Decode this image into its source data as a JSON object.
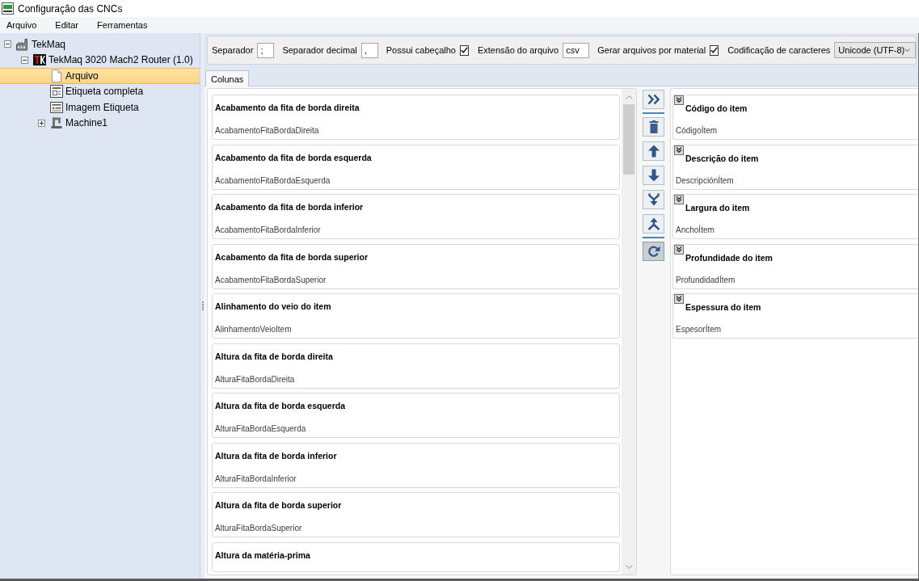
{
  "window": {
    "title": "Configuração das CNCs"
  },
  "menu": [
    "Arquivo",
    "Editar",
    "Ferramentas"
  ],
  "tree": [
    {
      "label": "TekMaq",
      "kind": "factory",
      "expanded": true,
      "selected": false,
      "children": [
        {
          "label": "TekMaq 3020 Mach2 Router (1.0)",
          "kind": "router",
          "expanded": true,
          "selected": false,
          "children": [
            {
              "label": "Arquivo",
              "kind": "file",
              "selected": true
            },
            {
              "label": "Etiqueta completa",
              "kind": "label",
              "selected": false
            },
            {
              "label": "Imagem Etiqueta",
              "kind": "image",
              "selected": false
            },
            {
              "label": "Machine1",
              "kind": "machine",
              "expanded": false,
              "selected": false
            }
          ]
        }
      ]
    }
  ],
  "options": [
    {
      "kind": "text",
      "label": "Separador",
      "value": ";"
    },
    {
      "kind": "text",
      "label": "Separador decimal",
      "value": ","
    },
    {
      "kind": "checkbox",
      "label": "Possui cabeçalho",
      "checked": true
    },
    {
      "kind": "text",
      "label": "Extensão do arquivo",
      "value": "csv"
    },
    {
      "kind": "checkbox",
      "label": "Gerar arquivos por material",
      "checked": true
    },
    {
      "kind": "dropdown",
      "label": "Codificação de caracteres",
      "value": "Unicode (UTF-8)"
    }
  ],
  "tabs": [
    {
      "label": "Colunas",
      "selected": true
    }
  ],
  "available_columns": [
    {
      "title": "Acabamento da fita de borda direita",
      "field": "AcabamentoFitaBordaDireita"
    },
    {
      "title": "Acabamento da fita de borda esquerda",
      "field": "AcabamentoFitaBordaEsquerda"
    },
    {
      "title": "Acabamento da fita de borda inferior",
      "field": "AcabamentoFitaBordaInferior"
    },
    {
      "title": "Acabamento da fita de borda superior",
      "field": "AcabamentoFitaBordaSuperior"
    },
    {
      "title": "Alinhamento do veio do item",
      "field": "AlinhamentoVeioItem"
    },
    {
      "title": "Altura da fita de borda direita",
      "field": "AlturaFitaBordaDireita"
    },
    {
      "title": "Altura da fita de borda esquerda",
      "field": "AlturaFitaBordaEsquerda"
    },
    {
      "title": "Altura da fita de borda inferior",
      "field": "AlturaFitaBordaInferior"
    },
    {
      "title": "Altura da fita de borda superior",
      "field": "AlturaFitaBordaSuperior"
    },
    {
      "title": "Altura da matéria-prima"
    }
  ],
  "column_actions": [
    {
      "kind": "forward",
      "pressed": false
    },
    {
      "kind": "separator"
    },
    {
      "kind": "delete",
      "pressed": false
    },
    {
      "kind": "up",
      "pressed": false
    },
    {
      "kind": "down",
      "pressed": false
    },
    {
      "kind": "merge",
      "pressed": false
    },
    {
      "kind": "split",
      "pressed": false
    },
    {
      "kind": "separator"
    },
    {
      "kind": "refresh",
      "pressed": true
    }
  ],
  "selected_columns": [
    {
      "title": "Código do item",
      "field": "CódigoÍtem"
    },
    {
      "title": "Descrição do item",
      "field": "DescripciónÍtem"
    },
    {
      "title": "Largura do item",
      "field": "AnchoÍtem"
    },
    {
      "title": "Profundidade do item",
      "field": "ProfundidadÍtem"
    },
    {
      "title": "Espessura do item",
      "field": "EspesorÍtem"
    }
  ]
}
